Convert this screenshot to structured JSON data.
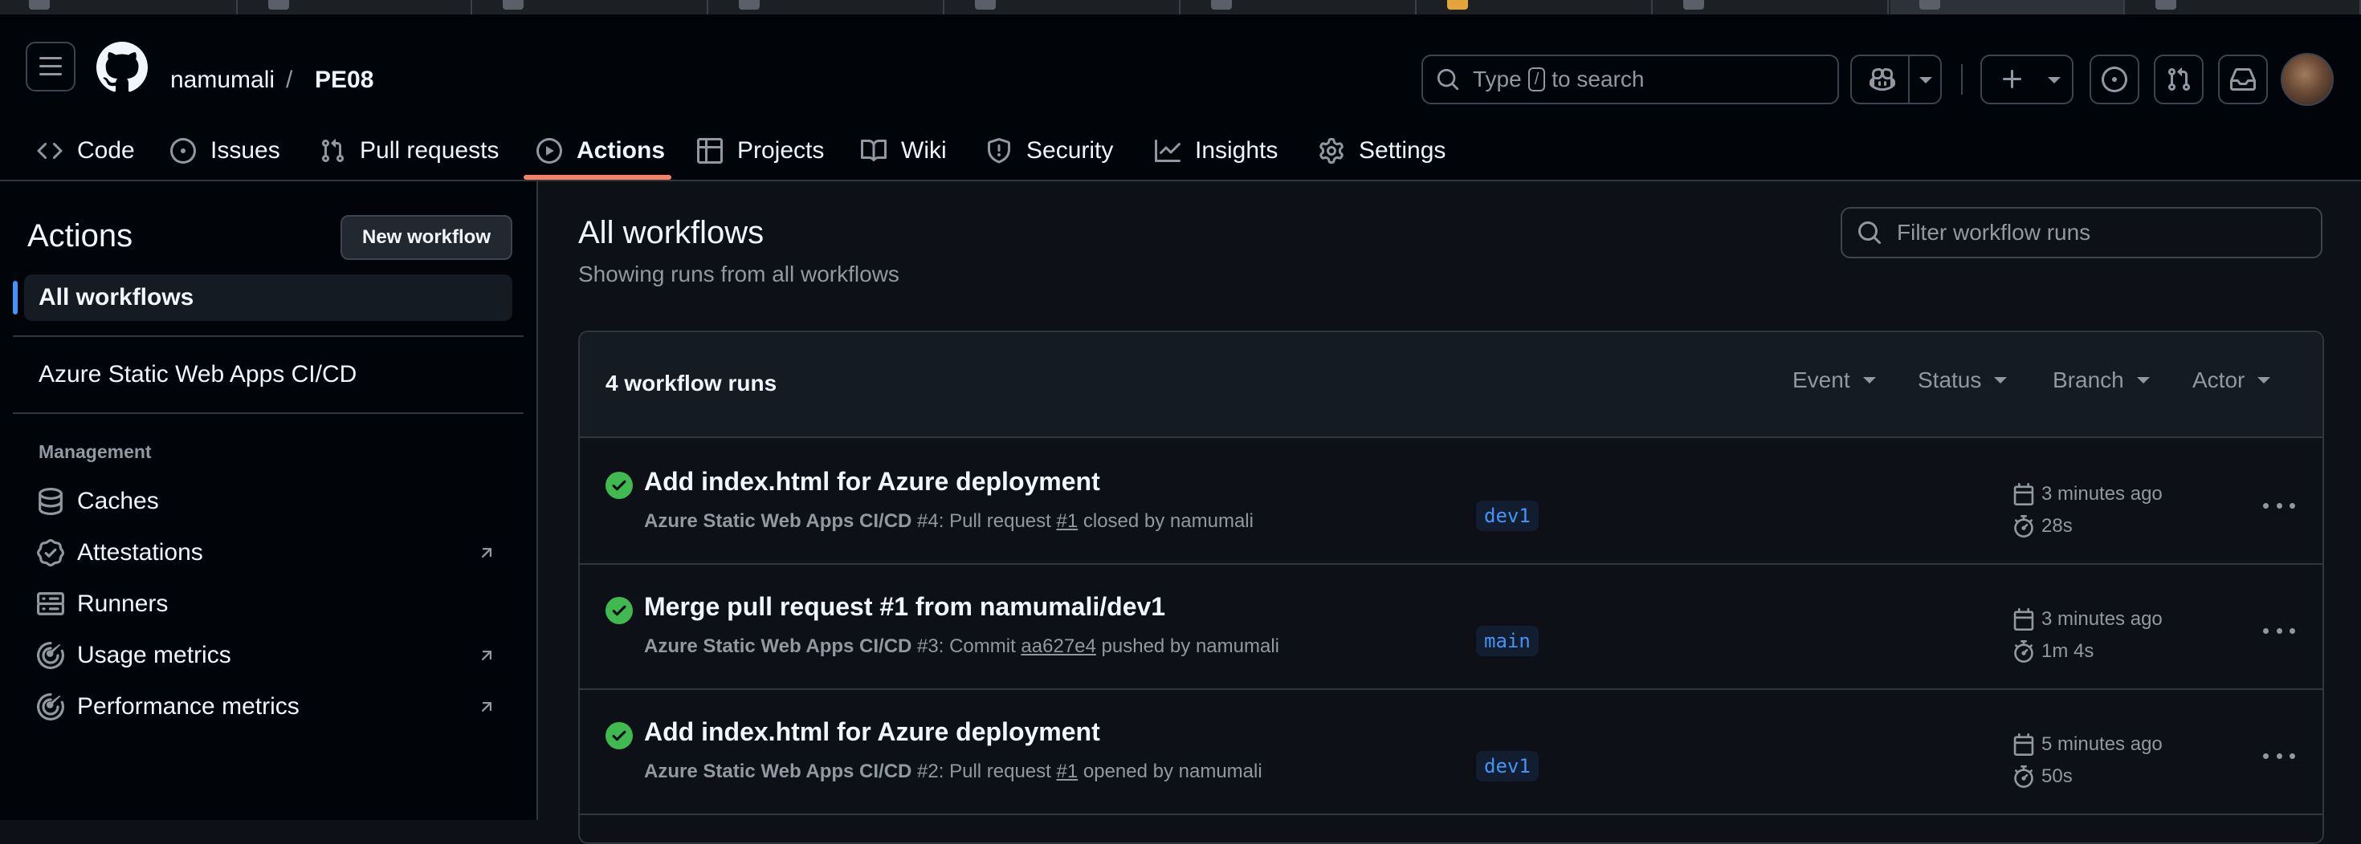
{
  "header": {
    "owner": "namumali",
    "separator": "/",
    "repo": "PE08",
    "search_prefix": "Type",
    "search_key": "/",
    "search_suffix": "to search"
  },
  "nav": {
    "tabs": [
      {
        "label": "Code",
        "icon": "code-icon"
      },
      {
        "label": "Issues",
        "icon": "issue-icon"
      },
      {
        "label": "Pull requests",
        "icon": "pull-request-icon"
      },
      {
        "label": "Actions",
        "icon": "play-icon",
        "selected": true
      },
      {
        "label": "Projects",
        "icon": "table-icon"
      },
      {
        "label": "Wiki",
        "icon": "book-icon"
      },
      {
        "label": "Security",
        "icon": "shield-icon"
      },
      {
        "label": "Insights",
        "icon": "graph-icon"
      },
      {
        "label": "Settings",
        "icon": "gear-icon"
      }
    ]
  },
  "sidebar": {
    "title": "Actions",
    "new_workflow": "New workflow",
    "all_workflows": "All workflows",
    "workflows": [
      "Azure Static Web Apps CI/CD"
    ],
    "management_label": "Management",
    "management": [
      {
        "label": "Caches",
        "icon": "database-icon"
      },
      {
        "label": "Attestations",
        "icon": "verified-icon",
        "external": true
      },
      {
        "label": "Runners",
        "icon": "server-icon"
      },
      {
        "label": "Usage metrics",
        "icon": "meter-icon",
        "external": true
      },
      {
        "label": "Performance metrics",
        "icon": "meter-icon",
        "external": true
      }
    ]
  },
  "main": {
    "title": "All workflows",
    "subtitle": "Showing runs from all workflows",
    "filter_placeholder": "Filter workflow runs",
    "runs_count": "4 workflow runs",
    "filters": [
      "Event",
      "Status",
      "Branch",
      "Actor"
    ],
    "runs": [
      {
        "title": "Add index.html for Azure deployment",
        "workflow": "Azure Static Web Apps CI/CD",
        "run_no": "#4",
        "trigger_text": ": Pull request ",
        "ref": "#1",
        "suffix": " closed by namumali",
        "branch": "dev1",
        "when": "3 minutes ago",
        "duration": "28s"
      },
      {
        "title": "Merge pull request #1 from namumali/dev1",
        "workflow": "Azure Static Web Apps CI/CD",
        "run_no": "#3",
        "trigger_text": ": Commit ",
        "ref": "aa627e4",
        "suffix": " pushed by namumali",
        "branch": "main",
        "when": "3 minutes ago",
        "duration": "1m 4s"
      },
      {
        "title": "Add index.html for Azure deployment",
        "workflow": "Azure Static Web Apps CI/CD",
        "run_no": "#2",
        "trigger_text": ": Pull request ",
        "ref": "#1",
        "suffix": " opened by namumali",
        "branch": "dev1",
        "when": "5 minutes ago",
        "duration": "50s"
      }
    ]
  },
  "colors": {
    "accent": "#f78166",
    "success": "#3fb950",
    "link": "#4493f8"
  }
}
